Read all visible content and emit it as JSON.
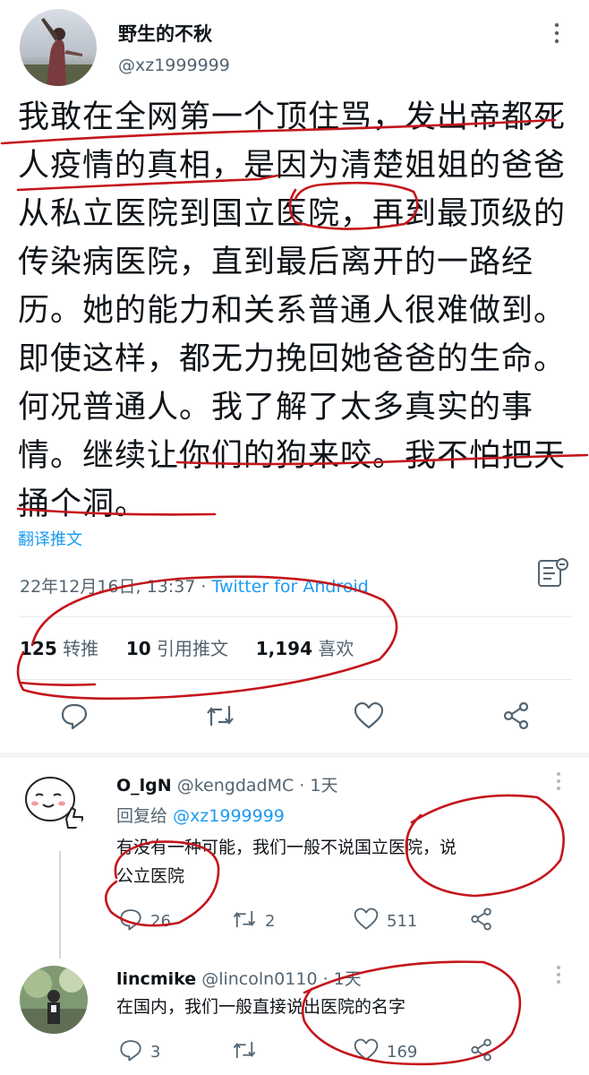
{
  "tweet": {
    "name": "野生的不秋",
    "handle": "@xz1999999",
    "text": "我敢在全网第一个顶住骂，发出帝都死人疫情的真相，是因为清楚姐姐的爸爸从私立医院到国立医院，再到最顶级的传染病医院，直到最后离开的一路经历。她的能力和关系普通人很难做到。即使这样，都无力挽回她爸爸的生命。何况普通人。我了解了太多真实的事情。继续让你们的狗来咬。我不怕把天捅个洞。",
    "translate": "翻译推文",
    "timestamp": "22年12月16日, 13:37 · ",
    "source": "Twitter for Android",
    "stats": {
      "retweets": "125",
      "retweets_label": "转推",
      "quotes": "10",
      "quotes_label": "引用推文",
      "likes": "1,194",
      "likes_label": "喜欢"
    },
    "icons": [
      "reply-icon",
      "retweet-icon",
      "like-icon",
      "share-icon",
      "more-icon",
      "analytics-icon"
    ]
  },
  "replies": [
    {
      "name": "O_lgN",
      "handle": "@kengdadMC · 1天",
      "replying_prefix": "回复给",
      "replying_to": "@xz1999999",
      "text_line1": "有没有一种可能，我们一般不说国立医院，说",
      "text_line2": "公立医院",
      "reply_count": "26",
      "retweet_count": "2",
      "like_count": "511"
    },
    {
      "name": "lincmike",
      "handle": "@lincoln0110 · 1天",
      "text_line1": "在国内，我们一般直接说出医院的名字",
      "reply_count": "3",
      "retweet_count": "",
      "like_count": "169"
    }
  ],
  "colors": {
    "text": "#0f1419",
    "secondary": "#536471",
    "link": "#1d9bf0",
    "annotation": "#c4161c"
  }
}
